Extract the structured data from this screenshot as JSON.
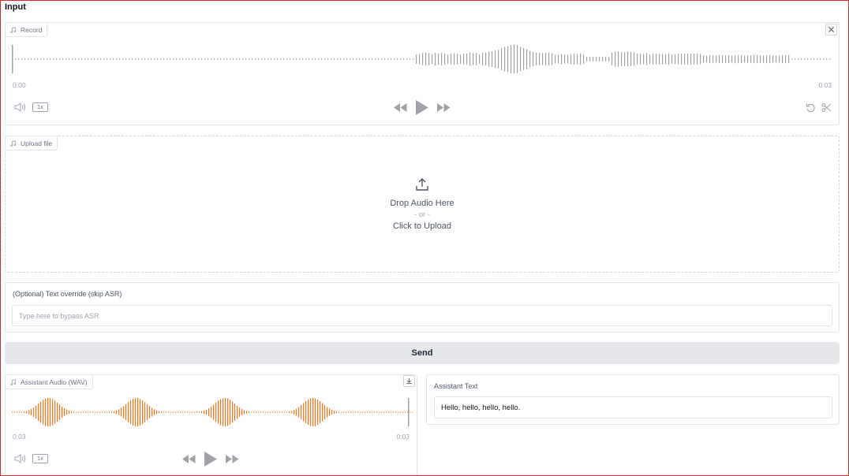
{
  "page": {
    "title": "Input"
  },
  "colors": {
    "recorded_wave": "#a1a1aa",
    "assistant_wave": "#f97316",
    "border": "#e4e4e7"
  },
  "record": {
    "label": "Record",
    "icon": "music-note-icon",
    "time_start": "0:00",
    "time_end": "0:03",
    "playback_rate": "1x"
  },
  "upload": {
    "label": "Upload file",
    "drop_text": "Drop Audio Here",
    "or_text": "- or -",
    "click_text": "Click to Upload"
  },
  "text_override": {
    "label": "(Optional) Text override (skip ASR)",
    "placeholder": "Type here to bypass ASR",
    "value": ""
  },
  "send": {
    "label": "Send"
  },
  "assistant_audio": {
    "label": "Assistant Audio (WAV)",
    "time_start": "0:03",
    "time_end": "0:03",
    "playback_rate": "1x"
  },
  "assistant_text": {
    "label": "Assistant Text",
    "value": "Hello, hello, hello, hello."
  }
}
